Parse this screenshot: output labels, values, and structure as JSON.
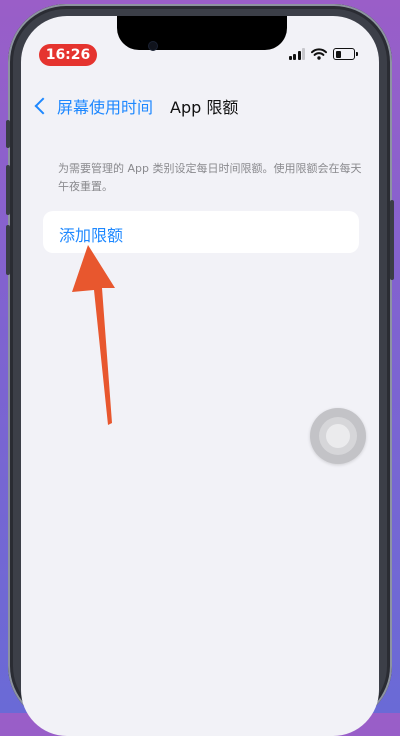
{
  "status_bar": {
    "time": "16:26",
    "time_pill_color": "#e5342f",
    "icons": [
      "cellular-signal-icon",
      "wifi-icon",
      "battery-icon"
    ]
  },
  "nav": {
    "back_label": "屏幕使用时间",
    "title": "App 限额"
  },
  "main": {
    "description": "为需要管理的 App 类别设定每日时间限额。使用限额会在每天午夜重置。",
    "add_limit_label": "添加限额"
  },
  "annotation": {
    "arrow_color": "#e8572e"
  },
  "colors": {
    "accent": "#1e88ff",
    "background": "#f2f2f7"
  }
}
